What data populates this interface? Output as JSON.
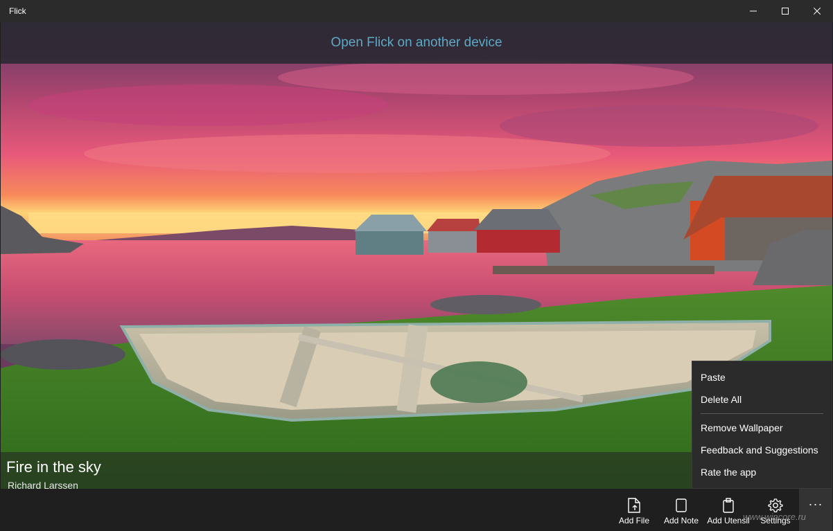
{
  "window": {
    "title": "Flick"
  },
  "banner": {
    "text": "Open Flick on another device"
  },
  "wallpaper": {
    "title": "Fire in the sky",
    "author": "Richard Larssen"
  },
  "context_menu": {
    "items": [
      "Paste",
      "Delete All",
      "Remove Wallpaper",
      "Feedback and Suggestions",
      "Rate the app"
    ]
  },
  "appbar": {
    "buttons": [
      {
        "label": "Add File",
        "icon": "add-file-icon"
      },
      {
        "label": "Add Note",
        "icon": "note-icon"
      },
      {
        "label": "Add Utensil",
        "icon": "clipboard-icon"
      },
      {
        "label": "Settings",
        "icon": "gear-icon"
      }
    ],
    "more": "···"
  },
  "watermark": "www.wincore.ru",
  "colors": {
    "banner_text": "#5ea9c5",
    "titlebar": "#2b2b2b",
    "appbar": "#1f1f1f",
    "menu": "#2b2b2b"
  }
}
